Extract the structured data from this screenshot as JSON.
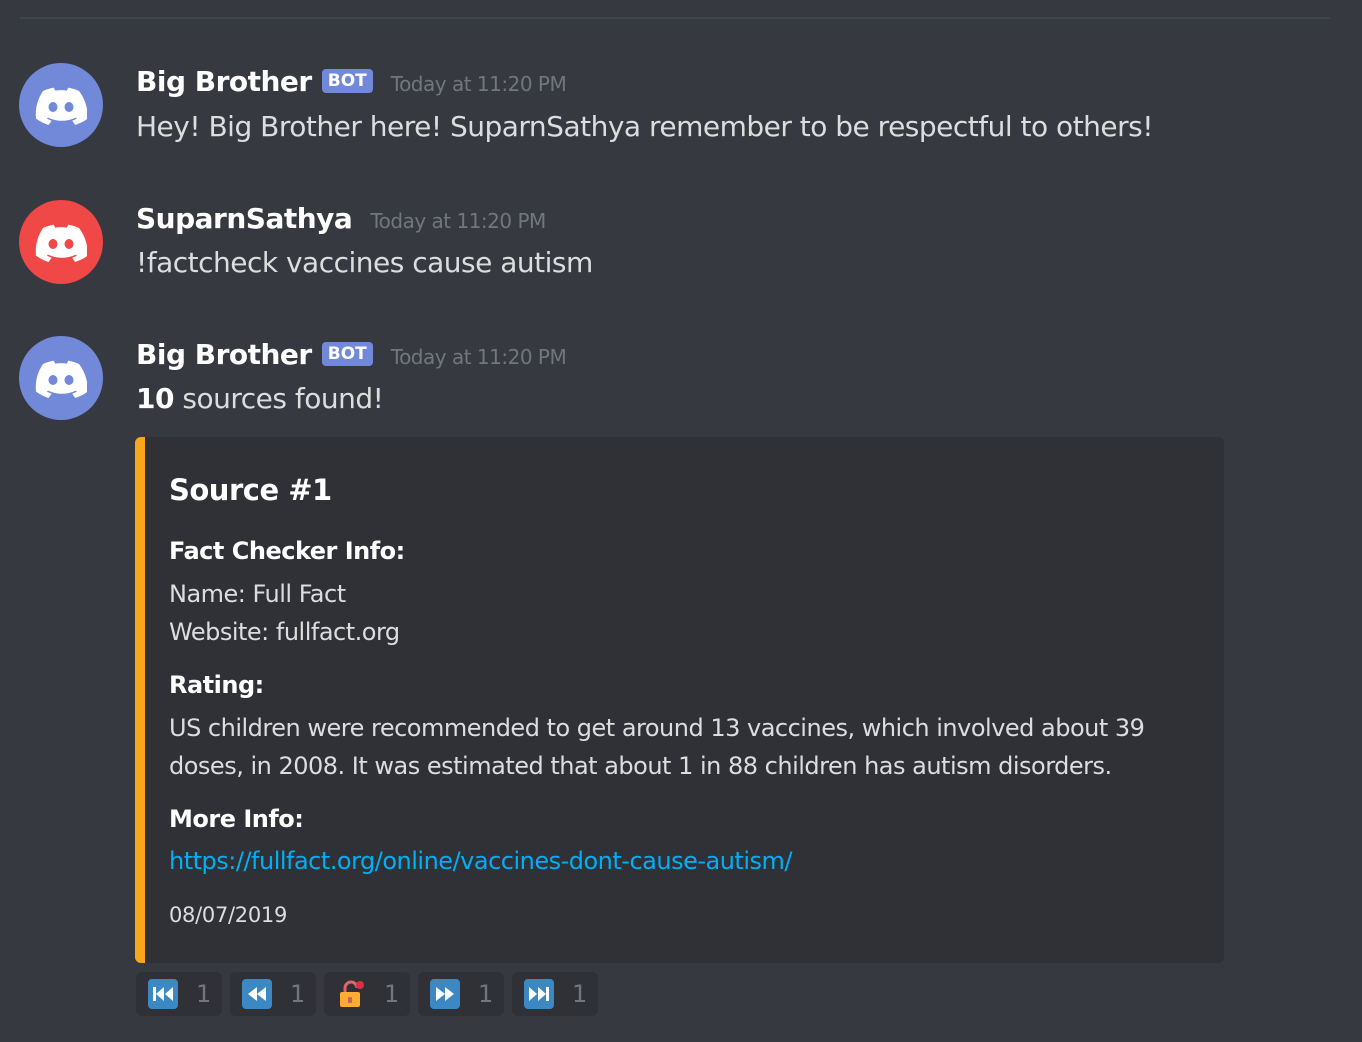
{
  "messages": [
    {
      "username": "Big Brother",
      "bot_tag": "BOT",
      "timestamp": "Today at 11:20 PM",
      "text": "Hey! Big Brother here! SuparnSathya remember to be respectful to others!",
      "avatar_color": "#7289da"
    },
    {
      "username": "SuparnSathya",
      "timestamp": "Today at 11:20 PM",
      "text": "!factcheck vaccines cause autism",
      "avatar_color": "#f04747"
    },
    {
      "username": "Big Brother",
      "bot_tag": "BOT",
      "timestamp": "Today at 11:20 PM",
      "text_bold": "10",
      "text_rest": " sources found!",
      "avatar_color": "#7289da"
    }
  ],
  "embed": {
    "accent_color": "#faa61a",
    "title": "Source #1",
    "fact_checker_label": "Fact Checker Info:",
    "name_line": "Name: Full Fact",
    "website_line": "Website: fullfact.org",
    "rating_label": "Rating:",
    "rating_line1": "US children were recommended to get around 13 vaccines, which involved about 39",
    "rating_line2": "doses, in 2008. It was estimated that about 1 in 88 children has autism disorders.",
    "more_info_label": "More Info:",
    "link": "https://fullfact.org/online/vaccines-dont-cause-autism/",
    "footer_date": "08/07/2019"
  },
  "reactions": [
    {
      "icon": "first-page-icon",
      "count": "1"
    },
    {
      "icon": "previous-page-icon",
      "count": "1"
    },
    {
      "icon": "lock-icon",
      "count": "1"
    },
    {
      "icon": "next-page-icon",
      "count": "1"
    },
    {
      "icon": "last-page-icon",
      "count": "1"
    }
  ]
}
